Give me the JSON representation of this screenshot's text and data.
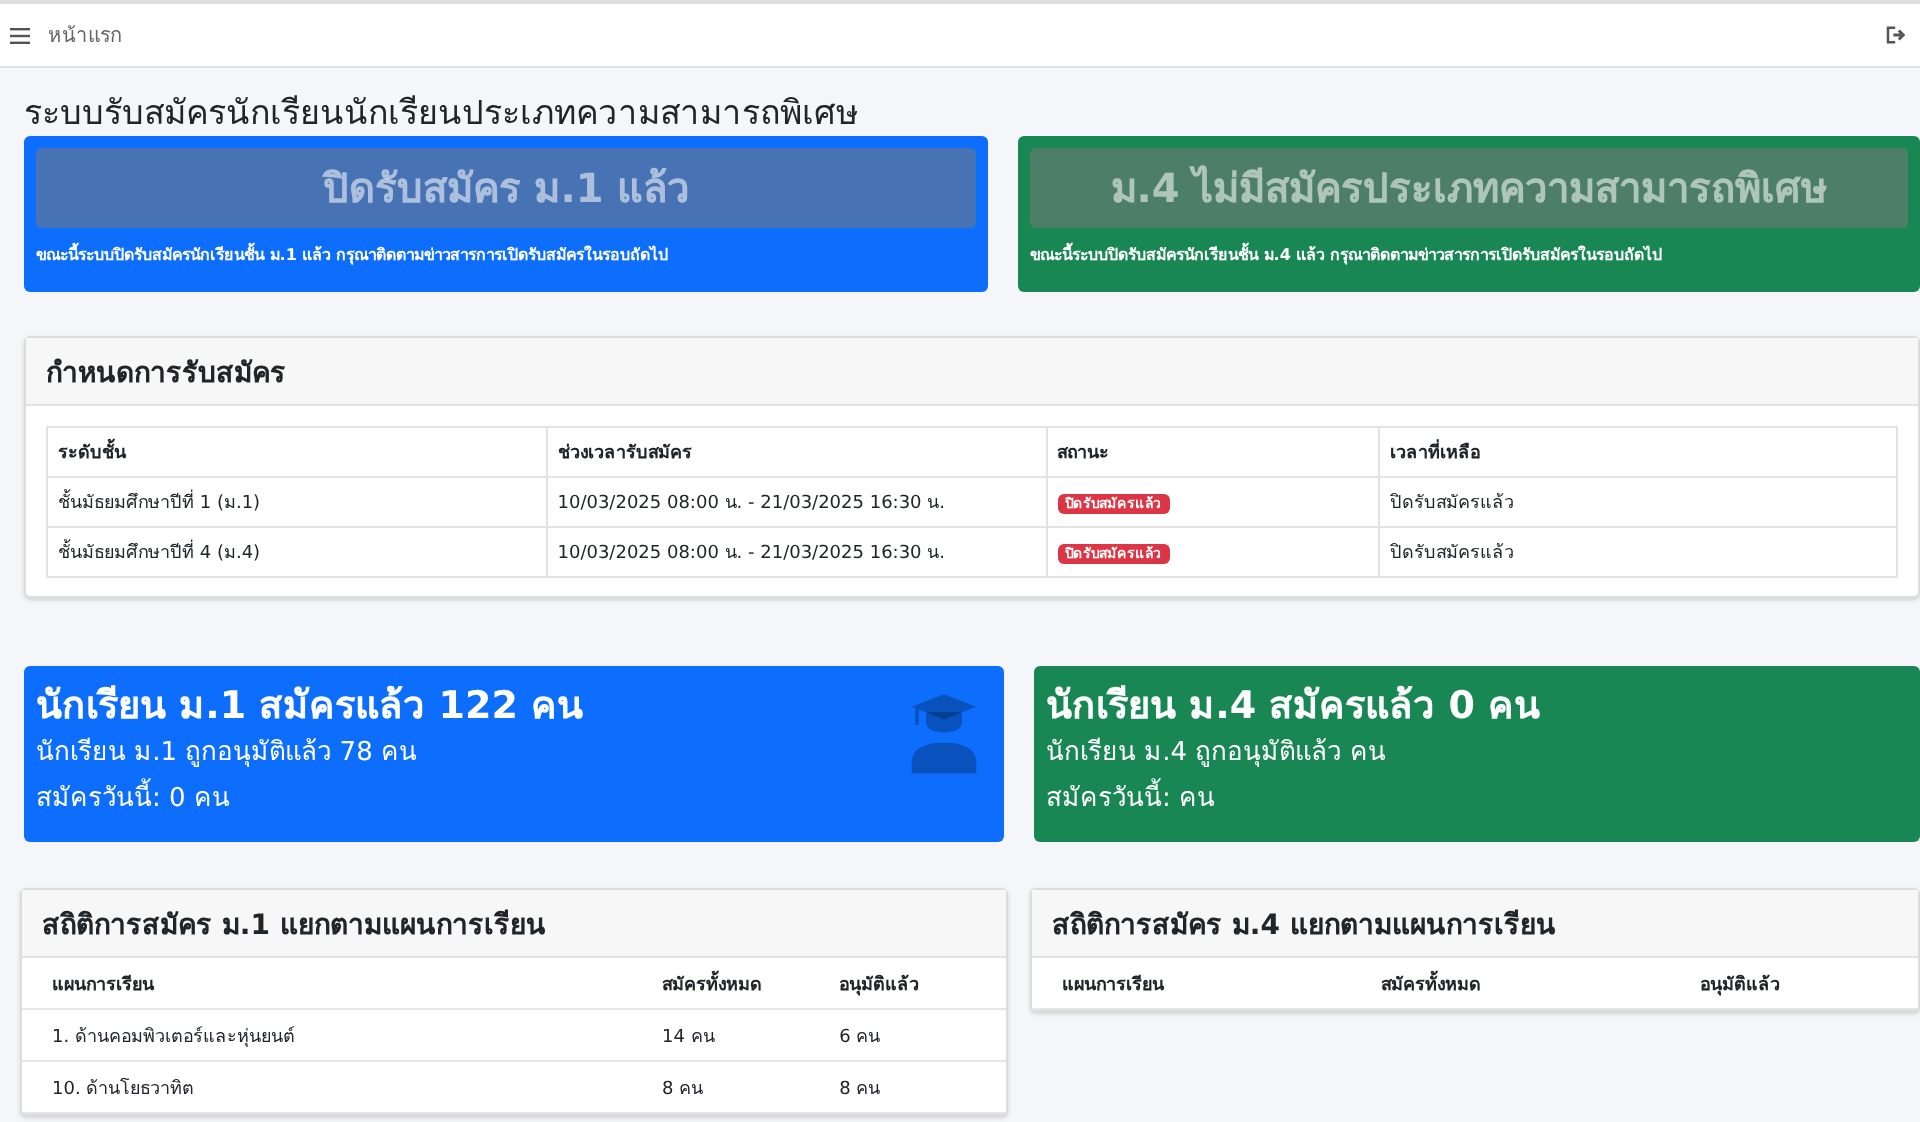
{
  "topbar": {
    "page_title": "หน้าแรก"
  },
  "heading": "ระบบรับสมัครนักเรียนนักเรียนประเภทความสามารถพิเศษ",
  "banners": [
    {
      "title": "ปิดรับสมัคร ม.1 แล้ว",
      "message": "ขณะนี้ระบบปิดรับสมัครนักเรียนชั้น ม.1 แล้ว กรุณาติดตามข่าวสารการเปิดรับสมัครในรอบถัดไป",
      "color": "#0d6efd"
    },
    {
      "title": "ม.4 ไม่มีสมัครประเภทความสามารถพิเศษ",
      "message": "ขณะนี้ระบบปิดรับสมัครนักเรียนชั้น ม.4 แล้ว กรุณาติดตามข่าวสารการเปิดรับสมัครในรอบถัดไป",
      "color": "#198754"
    }
  ],
  "schedule": {
    "title": "กำหนดการรับสมัคร",
    "columns": [
      "ระดับชั้น",
      "ช่วงเวลารับสมัคร",
      "สถานะ",
      "เวลาที่เหลือ"
    ],
    "rows": [
      {
        "level": "ชั้นมัธยมศึกษาปีที่ 1 (ม.1)",
        "period": "10/03/2025 08:00 น. - 21/03/2025 16:30 น.",
        "status": "ปิดรับสมัครแล้ว",
        "remaining": "ปิดรับสมัครแล้ว"
      },
      {
        "level": "ชั้นมัธยมศึกษาปีที่ 4 (ม.4)",
        "period": "10/03/2025 08:00 น. - 21/03/2025 16:30 น.",
        "status": "ปิดรับสมัครแล้ว",
        "remaining": "ปิดรับสมัครแล้ว"
      }
    ]
  },
  "summary_cards": [
    {
      "title": "นักเรียน ม.1 สมัครแล้ว 122 คน",
      "approved": "นักเรียน ม.1 ถูกอนุมัติแล้ว 78 คน",
      "today": "สมัครวันนี้: 0 คน",
      "color": "#0d6efd",
      "has_icon": true
    },
    {
      "title": "นักเรียน ม.4 สมัครแล้ว 0 คน",
      "approved": "นักเรียน ม.4 ถูกอนุมัติแล้ว คน",
      "today": "สมัครวันนี้: คน",
      "color": "#198754",
      "has_icon": false
    }
  ],
  "stats": [
    {
      "title": "สถิติการสมัคร ม.1 แยกตามแผนการเรียน",
      "columns": [
        "แผนการเรียน",
        "สมัครทั้งหมด",
        "อนุมัติแล้ว"
      ],
      "rows": [
        [
          "1. ด้านคอมพิวเตอร์และหุ่นยนต์",
          "14 คน",
          "6 คน"
        ],
        [
          "10. ด้านโยธวาทิต",
          "8 คน",
          "8 คน"
        ]
      ]
    },
    {
      "title": "สถิติการสมัคร ม.4 แยกตามแผนการเรียน",
      "columns": [
        "แผนการเรียน",
        "สมัครทั้งหมด",
        "อนุมัติแล้ว"
      ]
    }
  ]
}
